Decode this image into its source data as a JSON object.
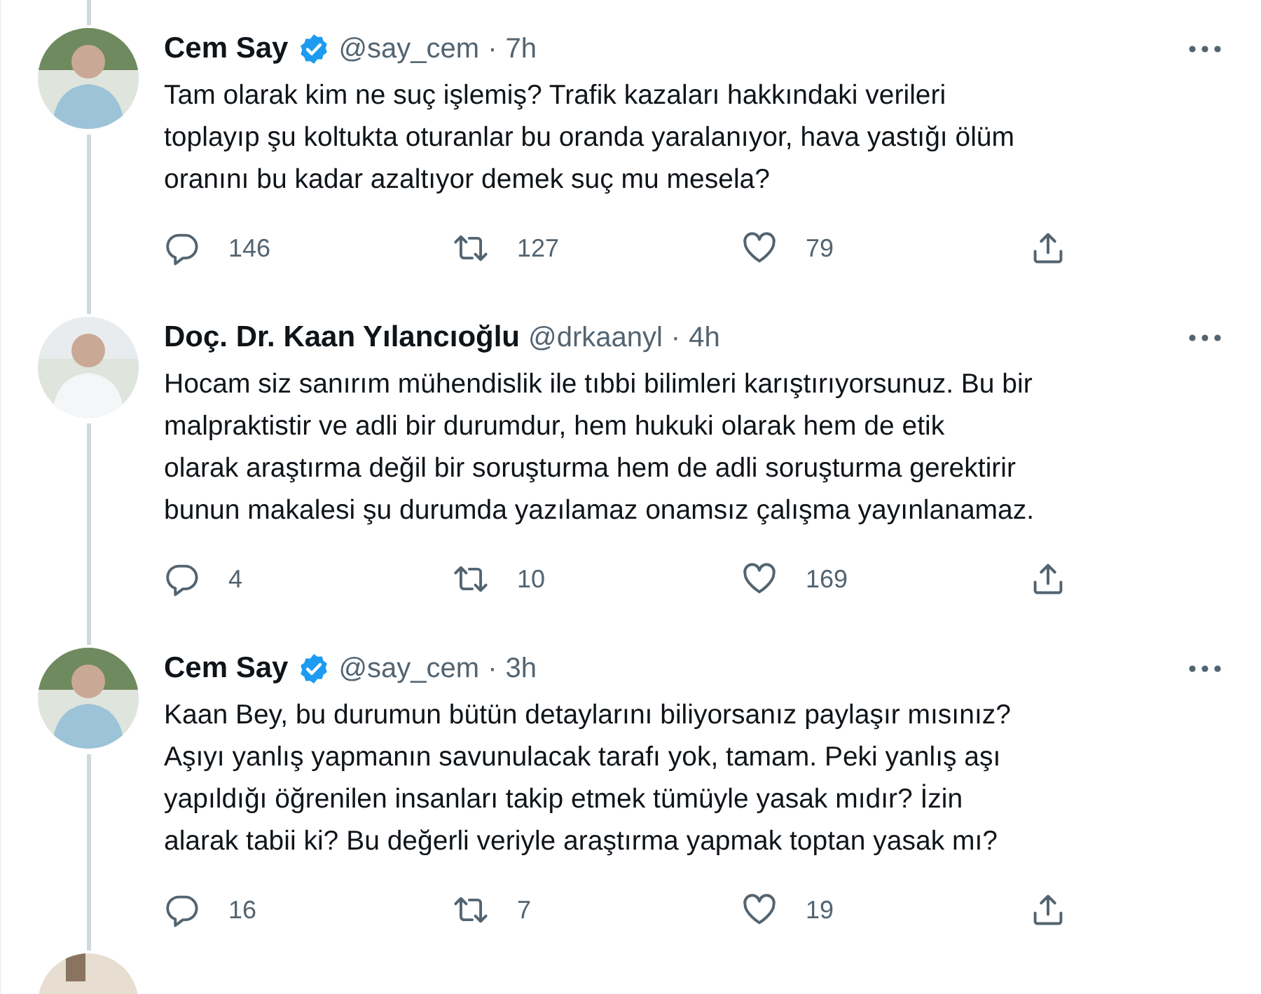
{
  "tweets": [
    {
      "name": "Cem Say",
      "verified": true,
      "handle": "@say_cem",
      "separator": "·",
      "time": "7h",
      "text": "Tam olarak kim ne suç işlemiş? Trafik kazaları hakkındaki verileri\ntoplayıp şu koltukta oturanlar bu oranda yaralanıyor, hava yastığı ölüm\noranını bu kadar azaltıyor demek suç mu mesela?",
      "replies": "146",
      "retweets": "127",
      "likes": "79"
    },
    {
      "name": "Doç. Dr. Kaan Yılancıoğlu",
      "verified": false,
      "handle": "@drkaanyl",
      "separator": "·",
      "time": "4h",
      "text": "Hocam siz sanırım mühendislik ile tıbbi bilimleri karıştırıyorsunuz. Bu bir\nmalpraktistir ve adli bir durumdur, hem hukuki olarak hem de etik\nolarak araştırma değil bir soruşturma hem de adli soruşturma gerektirir\nbunun makalesi şu durumda yazılamaz onamsız çalışma yayınlanamaz.",
      "replies": "4",
      "retweets": "10",
      "likes": "169"
    },
    {
      "name": "Cem Say",
      "verified": true,
      "handle": "@say_cem",
      "separator": "·",
      "time": "3h",
      "text": "Kaan Bey, bu durumun bütün detaylarını biliyorsanız paylaşır mısınız?\nAşıyı yanlış yapmanın savunulacak tarafı yok, tamam. Peki yanlış aşı\nyapıldığı öğrenilen insanları takip etmek tümüyle yasak mıdır? İzin\nalarak tabii ki? Bu değerli veriyle araştırma yapmak toptan yasak mı?",
      "replies": "16",
      "retweets": "7",
      "likes": "19"
    }
  ]
}
